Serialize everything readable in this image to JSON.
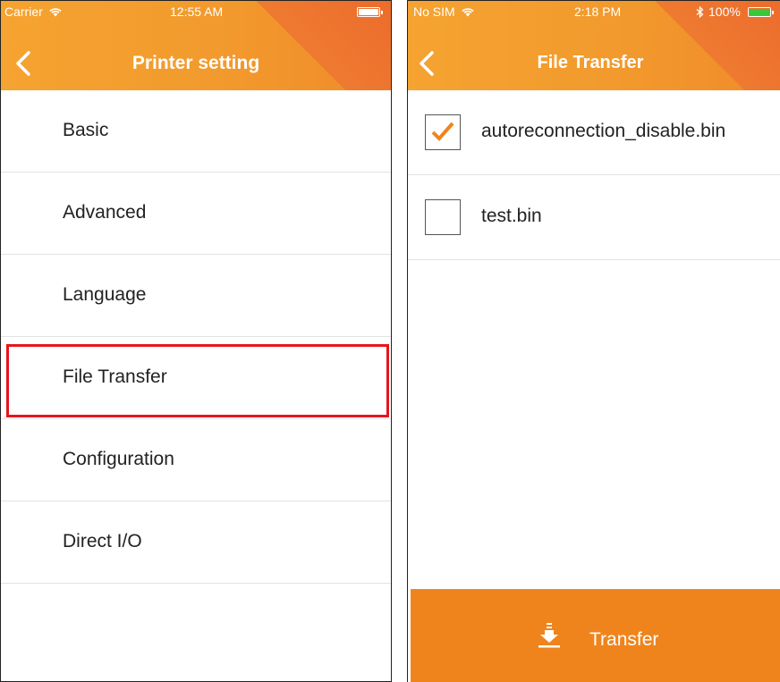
{
  "left_screen": {
    "status_bar": {
      "carrier": "Carrier",
      "time": "12:55 AM"
    },
    "nav": {
      "title": "Printer setting"
    },
    "menu_items": [
      {
        "label": "Basic"
      },
      {
        "label": "Advanced"
      },
      {
        "label": "Language"
      },
      {
        "label": "File Transfer",
        "highlighted": true
      },
      {
        "label": "Configuration"
      },
      {
        "label": "Direct I/O"
      }
    ],
    "highlight_color": "#e8141c"
  },
  "right_screen": {
    "status_bar": {
      "carrier": "No SIM",
      "time": "2:18 PM",
      "battery": "100%"
    },
    "nav": {
      "title": "File Transfer"
    },
    "files": [
      {
        "name": "autoreconnection_disable.bin",
        "checked": true
      },
      {
        "name": "test.bin",
        "checked": false
      }
    ],
    "transfer_button": {
      "label": "Transfer",
      "icon": "download-icon"
    }
  },
  "colors": {
    "header_orange": "#f29a2d",
    "header_accent": "#ee7430",
    "button_orange": "#f0841c",
    "check_orange": "#f0841c"
  }
}
